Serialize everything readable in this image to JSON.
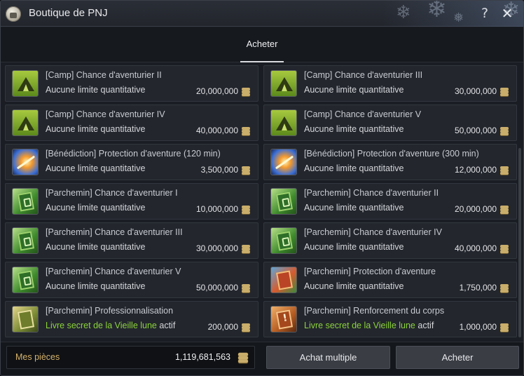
{
  "window": {
    "title": "Boutique de PNJ",
    "help_label": "?",
    "close_label": "✕"
  },
  "tabs": [
    {
      "label": "Acheter",
      "active": true
    }
  ],
  "items": [
    {
      "name": "[Camp] Chance d'aventurier II",
      "limit": "Aucune limite quantitative",
      "limit_suffix": "",
      "price": "20,000,000",
      "icon": "camp-tent-icon"
    },
    {
      "name": "[Camp] Chance d'aventurier III",
      "limit": "Aucune limite quantitative",
      "limit_suffix": "",
      "price": "30,000,000",
      "icon": "camp-tent-icon"
    },
    {
      "name": "[Camp] Chance d'aventurier IV",
      "limit": "Aucune limite quantitative",
      "limit_suffix": "",
      "price": "40,000,000",
      "icon": "camp-tent-icon"
    },
    {
      "name": "[Camp] Chance d'aventurier V",
      "limit": "Aucune limite quantitative",
      "limit_suffix": "",
      "price": "50,000,000",
      "icon": "camp-tent-icon"
    },
    {
      "name": "[Bénédiction] Protection d'aventure (120 min)",
      "limit": "Aucune limite quantitative",
      "limit_suffix": "",
      "price": "3,500,000",
      "icon": "blessing-icon"
    },
    {
      "name": "[Bénédiction] Protection d'aventure (300 min)",
      "limit": "Aucune limite quantitative",
      "limit_suffix": "",
      "price": "12,000,000",
      "icon": "blessing-icon"
    },
    {
      "name": "[Parchemin] Chance d'aventurier I",
      "limit": "Aucune limite quantitative",
      "limit_suffix": "",
      "price": "10,000,000",
      "icon": "green-scroll-icon"
    },
    {
      "name": "[Parchemin] Chance d'aventurier II",
      "limit": "Aucune limite quantitative",
      "limit_suffix": "",
      "price": "20,000,000",
      "icon": "green-scroll-icon"
    },
    {
      "name": "[Parchemin] Chance d'aventurier III",
      "limit": "Aucune limite quantitative",
      "limit_suffix": "",
      "price": "30,000,000",
      "icon": "green-scroll-icon"
    },
    {
      "name": "[Parchemin] Chance d'aventurier IV",
      "limit": "Aucune limite quantitative",
      "limit_suffix": "",
      "price": "40,000,000",
      "icon": "green-scroll-icon"
    },
    {
      "name": "[Parchemin] Chance d'aventurier V",
      "limit": "Aucune limite quantitative",
      "limit_suffix": "",
      "price": "50,000,000",
      "icon": "green-scroll-icon"
    },
    {
      "name": "[Parchemin] Protection d'aventure",
      "limit": "Aucune limite quantitative",
      "limit_suffix": "",
      "price": "1,750,000",
      "icon": "red-scroll-icon"
    },
    {
      "name": "[Parchemin] Professionnalisation",
      "limit": "Livre secret de la Vieille lune",
      "limit_suffix": "actif",
      "price": "200,000",
      "icon": "gold-scroll-icon"
    },
    {
      "name": "[Parchemin] Renforcement du corps",
      "limit": "Livre secret de la Vieille lune",
      "limit_suffix": "actif",
      "price": "1,000,000",
      "icon": "orange-scroll-icon"
    }
  ],
  "footer": {
    "coins_label": "Mes pièces",
    "coins_value": "1,119,681,563",
    "multi_buy_label": "Achat multiple",
    "buy_label": "Acheter"
  },
  "colors": {
    "highlight_green": "#8bd33a",
    "coins_label": "#d6b26b",
    "panel_bg": "#1a1d23"
  }
}
